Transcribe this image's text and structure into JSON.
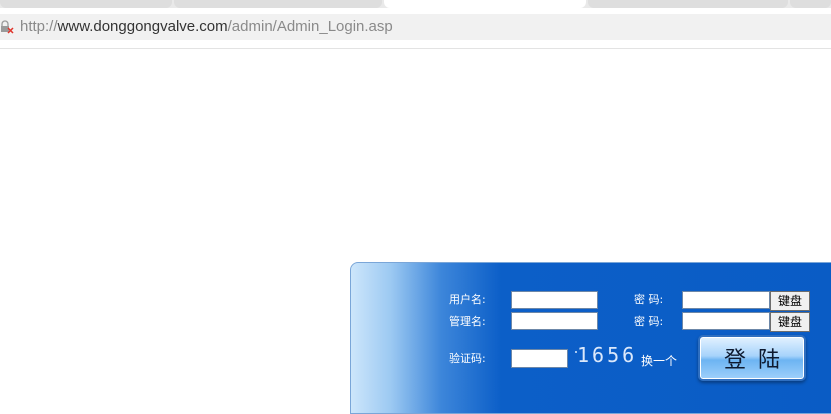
{
  "browser": {
    "url_scheme": "http://",
    "url_domain": "www.donggongvalve.com",
    "url_path": "/admin/Admin_Login.asp",
    "lock_icon": "insecure-lock-icon"
  },
  "login": {
    "username_label": "用户名:",
    "password_label_1": "密 码:",
    "keyboard_label_1": "键盘",
    "admin_label": "管理名:",
    "password_label_2": "密 码:",
    "keyboard_label_2": "键盘",
    "captcha_label": "验证码:",
    "captcha_code": "1656",
    "refresh_label": "换一个",
    "submit_label": "登陆",
    "username_value": "",
    "password_value": "",
    "admin_value": "",
    "admin_password_value": "",
    "captcha_value": ""
  },
  "colors": {
    "panel_blue": "#0a5cc5",
    "panel_light": "#cde6fb"
  }
}
